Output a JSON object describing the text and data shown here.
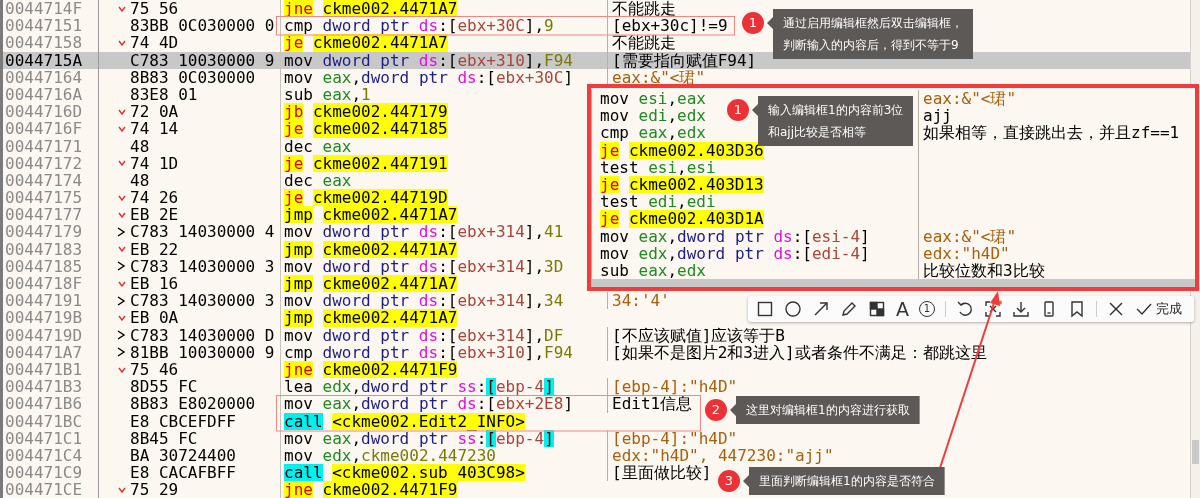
{
  "listing": {
    "rows": [
      {
        "address": "0044714F",
        "bytes": "75 56",
        "kind": "jump",
        "selected": false,
        "asm": [
          {
            "kind": "jcc",
            "text": "jne"
          },
          {
            "kind": "tgt",
            "text": "ckme002.4471A7"
          }
        ],
        "comment": {
          "text": "不能跳走",
          "kind": "user"
        }
      },
      {
        "address": "00447151",
        "bytes": "83BB 0C030000 0",
        "kind": "plain",
        "selected": false,
        "asm": [
          {
            "kind": "op",
            "text": "cmp"
          },
          {
            "kind": "ptr",
            "text": "dword ptr"
          },
          {
            "kind": "seg",
            "text": "ds"
          },
          {
            "kind": "p",
            "text": ":["
          },
          {
            "kind": "mem",
            "text": "ebx+30C"
          },
          {
            "kind": "p",
            "text": "],"
          },
          {
            "kind": "num",
            "text": "9"
          }
        ],
        "comment": {
          "text": "[ebx+30c]!=9",
          "kind": "user"
        }
      },
      {
        "address": "00447158",
        "bytes": "74 4D",
        "kind": "jump",
        "selected": false,
        "asm": [
          {
            "kind": "jcc",
            "text": "je"
          },
          {
            "kind": "tgt",
            "text": "ckme002.4471A7"
          }
        ],
        "comment": {
          "text": "不能跳走",
          "kind": "user"
        }
      },
      {
        "address": "0044715A",
        "bytes": "C783 10030000 9",
        "kind": "plain",
        "selected": true,
        "asm": [
          {
            "kind": "op",
            "text": "mov"
          },
          {
            "kind": "ptr",
            "text": "dword ptr"
          },
          {
            "kind": "seg",
            "text": "ds"
          },
          {
            "kind": "p",
            "text": ":["
          },
          {
            "kind": "mem",
            "text": "ebx+310"
          },
          {
            "kind": "p",
            "text": "],"
          },
          {
            "kind": "num",
            "text": "F94"
          }
        ],
        "comment": {
          "text": "[需要指向赋值F94]",
          "kind": "user"
        }
      },
      {
        "address": "00447164",
        "bytes": "8B83 0C030000",
        "kind": "plain",
        "selected": false,
        "asm": [
          {
            "kind": "op",
            "text": "mov"
          },
          {
            "kind": "reg",
            "text": "eax"
          },
          {
            "kind": "p",
            "text": ","
          },
          {
            "kind": "ptr",
            "text": "dword ptr"
          },
          {
            "kind": "seg",
            "text": "ds"
          },
          {
            "kind": "p",
            "text": ":["
          },
          {
            "kind": "mem",
            "text": "ebx+30C"
          },
          {
            "kind": "p",
            "text": "]"
          }
        ],
        "comment": {
          "text": "eax:&\"<珺\"",
          "kind": "auto"
        }
      },
      {
        "address": "0044716A",
        "bytes": "83E8 01",
        "kind": "plain",
        "selected": false,
        "asm": [
          {
            "kind": "op",
            "text": "sub"
          },
          {
            "kind": "reg",
            "text": "eax"
          },
          {
            "kind": "p",
            "text": ","
          },
          {
            "kind": "num",
            "text": "1"
          }
        ]
      },
      {
        "address": "0044716D",
        "bytes": "72 0A",
        "kind": "jump",
        "selected": false,
        "asm": [
          {
            "kind": "jcc",
            "text": "jb"
          },
          {
            "kind": "tgt",
            "text": "ckme002.447179"
          }
        ]
      },
      {
        "address": "0044716F",
        "bytes": "74 14",
        "kind": "jump",
        "selected": false,
        "asm": [
          {
            "kind": "jcc",
            "text": "je"
          },
          {
            "kind": "tgt",
            "text": "ckme002.447185"
          }
        ]
      },
      {
        "address": "00447171",
        "bytes": "48",
        "kind": "plain",
        "selected": false,
        "asm": [
          {
            "kind": "op",
            "text": "dec"
          },
          {
            "kind": "reg",
            "text": "eax"
          }
        ]
      },
      {
        "address": "00447172",
        "bytes": "74 1D",
        "kind": "jump",
        "selected": false,
        "asm": [
          {
            "kind": "jcc",
            "text": "je"
          },
          {
            "kind": "tgt",
            "text": "ckme002.447191"
          }
        ]
      },
      {
        "address": "00447174",
        "bytes": "48",
        "kind": "plain",
        "selected": false,
        "asm": [
          {
            "kind": "op",
            "text": "dec"
          },
          {
            "kind": "reg",
            "text": "eax"
          }
        ]
      },
      {
        "address": "00447175",
        "bytes": "74 26",
        "kind": "jump",
        "selected": false,
        "asm": [
          {
            "kind": "jcc",
            "text": "je"
          },
          {
            "kind": "tgt",
            "text": "ckme002.44719D"
          }
        ]
      },
      {
        "address": "00447177",
        "bytes": "EB 2E",
        "kind": "jump",
        "selected": false,
        "asm": [
          {
            "kind": "jmp",
            "text": "jmp"
          },
          {
            "kind": "tgt",
            "text": "ckme002.4471A7"
          }
        ]
      },
      {
        "address": "00447179",
        "bytes": "C783 14030000 4",
        "kind": "target",
        "selected": false,
        "asm": [
          {
            "kind": "op",
            "text": "mov"
          },
          {
            "kind": "ptr",
            "text": "dword ptr"
          },
          {
            "kind": "seg",
            "text": "ds"
          },
          {
            "kind": "p",
            "text": ":["
          },
          {
            "kind": "mem",
            "text": "ebx+314"
          },
          {
            "kind": "p",
            "text": "],"
          },
          {
            "kind": "num",
            "text": "41"
          }
        ]
      },
      {
        "address": "00447183",
        "bytes": "EB 22",
        "kind": "jump",
        "selected": false,
        "asm": [
          {
            "kind": "jmp",
            "text": "jmp"
          },
          {
            "kind": "tgt",
            "text": "ckme002.4471A7"
          }
        ]
      },
      {
        "address": "00447185",
        "bytes": "C783 14030000 3",
        "kind": "target",
        "selected": false,
        "asm": [
          {
            "kind": "op",
            "text": "mov"
          },
          {
            "kind": "ptr",
            "text": "dword ptr"
          },
          {
            "kind": "seg",
            "text": "ds"
          },
          {
            "kind": "p",
            "text": ":["
          },
          {
            "kind": "mem",
            "text": "ebx+314"
          },
          {
            "kind": "p",
            "text": "],"
          },
          {
            "kind": "num",
            "text": "3D"
          }
        ]
      },
      {
        "address": "0044718F",
        "bytes": "EB 16",
        "kind": "jump",
        "selected": false,
        "asm": [
          {
            "kind": "jmp",
            "text": "jmp"
          },
          {
            "kind": "tgt",
            "text": "ckme002.4471A7"
          }
        ]
      },
      {
        "address": "00447191",
        "bytes": "C783 14030000 3",
        "kind": "target",
        "selected": false,
        "asm": [
          {
            "kind": "op",
            "text": "mov"
          },
          {
            "kind": "ptr",
            "text": "dword ptr"
          },
          {
            "kind": "seg",
            "text": "ds"
          },
          {
            "kind": "p",
            "text": ":["
          },
          {
            "kind": "mem",
            "text": "ebx+314"
          },
          {
            "kind": "p",
            "text": "],"
          },
          {
            "kind": "num",
            "text": "34"
          }
        ],
        "comment": {
          "text": "34:'4'",
          "kind": "auto"
        }
      },
      {
        "address": "0044719B",
        "bytes": "EB 0A",
        "kind": "jump",
        "selected": false,
        "asm": [
          {
            "kind": "jmp",
            "text": "jmp"
          },
          {
            "kind": "tgt",
            "text": "ckme002.4471A7"
          }
        ]
      },
      {
        "address": "0044719D",
        "bytes": "C783 14030000 D",
        "kind": "target",
        "selected": false,
        "asm": [
          {
            "kind": "op",
            "text": "mov"
          },
          {
            "kind": "ptr",
            "text": "dword ptr"
          },
          {
            "kind": "seg",
            "text": "ds"
          },
          {
            "kind": "p",
            "text": ":["
          },
          {
            "kind": "mem",
            "text": "ebx+314"
          },
          {
            "kind": "p",
            "text": "],"
          },
          {
            "kind": "num",
            "text": "DF"
          }
        ],
        "comment": {
          "text": "[不应该赋值]应该等于B",
          "kind": "user"
        }
      },
      {
        "address": "004471A7",
        "bytes": "81BB 10030000 9",
        "kind": "target",
        "selected": false,
        "asm": [
          {
            "kind": "op",
            "text": "cmp"
          },
          {
            "kind": "ptr",
            "text": "dword ptr"
          },
          {
            "kind": "seg",
            "text": "ds"
          },
          {
            "kind": "p",
            "text": ":["
          },
          {
            "kind": "mem",
            "text": "ebx+310"
          },
          {
            "kind": "p",
            "text": "],"
          },
          {
            "kind": "num",
            "text": "F94"
          }
        ],
        "comment": {
          "text": "[如果不是图片2和3进入]或者条件不满足：都跳这里",
          "kind": "user"
        }
      },
      {
        "address": "004471B1",
        "bytes": "75 46",
        "kind": "jump",
        "selected": false,
        "asm": [
          {
            "kind": "jcc",
            "text": "jne"
          },
          {
            "kind": "tgt",
            "text": "ckme002.4471F9"
          }
        ]
      },
      {
        "address": "004471B3",
        "bytes": "8D55 FC",
        "kind": "plain",
        "selected": false,
        "asm": [
          {
            "kind": "op",
            "text": "lea"
          },
          {
            "kind": "reg",
            "text": "edx"
          },
          {
            "kind": "p",
            "text": ","
          },
          {
            "kind": "ptr",
            "text": "dword ptr"
          },
          {
            "kind": "seg",
            "text": "ss"
          },
          {
            "kind": "p",
            "text": ":"
          },
          {
            "kind": "brc",
            "text": "["
          },
          {
            "kind": "mem",
            "text": "ebp-4"
          },
          {
            "kind": "brc",
            "text": "]"
          }
        ],
        "comment": {
          "text": "[ebp-4]:\"h4D\"",
          "kind": "auto"
        }
      },
      {
        "address": "004471B6",
        "bytes": "8B83 E8020000",
        "kind": "plain",
        "selected": false,
        "asm": [
          {
            "kind": "op",
            "text": "mov"
          },
          {
            "kind": "reg",
            "text": "eax"
          },
          {
            "kind": "p",
            "text": ","
          },
          {
            "kind": "ptr",
            "text": "dword ptr"
          },
          {
            "kind": "seg",
            "text": "ds"
          },
          {
            "kind": "p",
            "text": ":["
          },
          {
            "kind": "mem",
            "text": "ebx+2E8"
          },
          {
            "kind": "p",
            "text": "]"
          }
        ],
        "comment": {
          "text": "Edit1信息",
          "kind": "user"
        }
      },
      {
        "address": "004471BC",
        "bytes": "E8 CBCEFDFF",
        "kind": "plain",
        "selected": false,
        "asm": [
          {
            "kind": "call",
            "text": "call"
          },
          {
            "kind": "tgt",
            "text": "<ckme002.Edit2_INFO>"
          }
        ]
      },
      {
        "address": "004471C1",
        "bytes": "8B45 FC",
        "kind": "plain",
        "selected": false,
        "asm": [
          {
            "kind": "op",
            "text": "mov"
          },
          {
            "kind": "reg",
            "text": "eax"
          },
          {
            "kind": "p",
            "text": ","
          },
          {
            "kind": "ptr",
            "text": "dword ptr"
          },
          {
            "kind": "seg",
            "text": "ss"
          },
          {
            "kind": "p",
            "text": ":"
          },
          {
            "kind": "brc",
            "text": "["
          },
          {
            "kind": "mem",
            "text": "ebp-4"
          },
          {
            "kind": "brc",
            "text": "]"
          }
        ],
        "comment": {
          "text": "[ebp-4]:\"h4D\"",
          "kind": "auto"
        }
      },
      {
        "address": "004471C4",
        "bytes": "BA 30724400",
        "kind": "plain",
        "selected": false,
        "asm": [
          {
            "kind": "op",
            "text": "mov"
          },
          {
            "kind": "reg",
            "text": "edx"
          },
          {
            "kind": "p",
            "text": ","
          },
          {
            "kind": "num",
            "text": "ckme002.447230"
          }
        ],
        "comment": {
          "text": "edx:\"h4D\", 447230:\"ajj\"",
          "kind": "auto"
        }
      },
      {
        "address": "004471C9",
        "bytes": "E8 CACAFBFF",
        "kind": "plain",
        "selected": false,
        "asm": [
          {
            "kind": "call",
            "text": "call"
          },
          {
            "kind": "tgt",
            "text": "<ckme002.sub_403C98>"
          }
        ],
        "comment": {
          "text": "[里面做比较]",
          "kind": "user"
        }
      },
      {
        "address": "004471CE",
        "bytes": "75 29",
        "kind": "jump",
        "selected": false,
        "asm": [
          {
            "kind": "jcc",
            "text": "jne"
          },
          {
            "kind": "tgt",
            "text": "ckme002.4471F9"
          }
        ]
      }
    ]
  },
  "snippet": {
    "rows": [
      {
        "asm": [
          {
            "kind": "op",
            "text": "mov"
          },
          {
            "kind": "reg",
            "text": "esi"
          },
          {
            "kind": "p",
            "text": ","
          },
          {
            "kind": "reg",
            "text": "eax"
          }
        ],
        "comment": {
          "text": "eax:&\"<珺\"",
          "kind": "auto"
        }
      },
      {
        "asm": [
          {
            "kind": "op",
            "text": "mov"
          },
          {
            "kind": "reg",
            "text": "edi"
          },
          {
            "kind": "p",
            "text": ","
          },
          {
            "kind": "reg",
            "text": "edx"
          }
        ],
        "comment": {
          "text": "ajj",
          "kind": "user"
        }
      },
      {
        "asm": [
          {
            "kind": "op",
            "text": "cmp"
          },
          {
            "kind": "reg",
            "text": "eax"
          },
          {
            "kind": "p",
            "text": ","
          },
          {
            "kind": "reg",
            "text": "edx"
          }
        ],
        "comment": {
          "text": "如果相等，直接跳出去，并且zf==1",
          "kind": "user"
        }
      },
      {
        "asm": [
          {
            "kind": "jcc",
            "text": "je"
          },
          {
            "kind": "tgt",
            "text": "ckme002.403D36"
          }
        ]
      },
      {
        "asm": [
          {
            "kind": "op",
            "text": "test"
          },
          {
            "kind": "reg",
            "text": "esi"
          },
          {
            "kind": "p",
            "text": ","
          },
          {
            "kind": "reg",
            "text": "esi"
          }
        ]
      },
      {
        "asm": [
          {
            "kind": "jcc",
            "text": "je"
          },
          {
            "kind": "tgt",
            "text": "ckme002.403D13"
          }
        ]
      },
      {
        "asm": [
          {
            "kind": "op",
            "text": "test"
          },
          {
            "kind": "reg",
            "text": "edi"
          },
          {
            "kind": "p",
            "text": ","
          },
          {
            "kind": "reg",
            "text": "edi"
          }
        ]
      },
      {
        "asm": [
          {
            "kind": "jcc",
            "text": "je"
          },
          {
            "kind": "tgt",
            "text": "ckme002.403D1A"
          }
        ]
      },
      {
        "asm": [
          {
            "kind": "op",
            "text": "mov"
          },
          {
            "kind": "reg",
            "text": "eax"
          },
          {
            "kind": "p",
            "text": ","
          },
          {
            "kind": "ptr",
            "text": "dword ptr"
          },
          {
            "kind": "seg",
            "text": "ds"
          },
          {
            "kind": "p",
            "text": ":["
          },
          {
            "kind": "mem",
            "text": "esi-4"
          },
          {
            "kind": "p",
            "text": "]"
          }
        ],
        "comment": {
          "text": "eax:&\"<珺\"",
          "kind": "auto"
        }
      },
      {
        "asm": [
          {
            "kind": "op",
            "text": "mov"
          },
          {
            "kind": "reg",
            "text": "edx"
          },
          {
            "kind": "p",
            "text": ","
          },
          {
            "kind": "ptr",
            "text": "dword ptr"
          },
          {
            "kind": "seg",
            "text": "ds"
          },
          {
            "kind": "p",
            "text": ":["
          },
          {
            "kind": "mem",
            "text": "edi-4"
          },
          {
            "kind": "p",
            "text": "]"
          }
        ],
        "comment": {
          "text": "edx:\"h4D\"",
          "kind": "auto"
        }
      },
      {
        "asm": [
          {
            "kind": "op",
            "text": "sub"
          },
          {
            "kind": "reg",
            "text": "eax"
          },
          {
            "kind": "p",
            "text": ","
          },
          {
            "kind": "reg",
            "text": "edx"
          }
        ],
        "comment": {
          "text": "比较位数和3比较",
          "kind": "user"
        }
      }
    ]
  },
  "annotations": [
    {
      "number": "1",
      "lines": [
        "通过启用编辑框然后双击编辑框，",
        "判断输入的内容后，得到不等于9"
      ]
    },
    {
      "number": "1",
      "lines": [
        "输入编辑框1的内容前3位",
        "和ajj比较是否相等"
      ]
    },
    {
      "number": "2",
      "lines": [
        "这里对编辑框1的内容进行获取"
      ]
    },
    {
      "number": "3",
      "lines": [
        "里面判断编辑框1的内容是否符合"
      ]
    }
  ],
  "capture_toolbar": {
    "tools": [
      {
        "kind": "rectangle"
      },
      {
        "kind": "ellipse"
      },
      {
        "kind": "arrow"
      },
      {
        "kind": "pencil"
      },
      {
        "kind": "mosaic"
      },
      {
        "kind": "text",
        "glyph": "A"
      },
      {
        "kind": "number",
        "glyph": "1"
      },
      {
        "kind": "undo"
      },
      {
        "kind": "ocr"
      },
      {
        "kind": "download"
      },
      {
        "kind": "pin"
      },
      {
        "kind": "bookmark"
      },
      {
        "kind": "close"
      },
      {
        "kind": "done",
        "label": "完成"
      }
    ]
  }
}
